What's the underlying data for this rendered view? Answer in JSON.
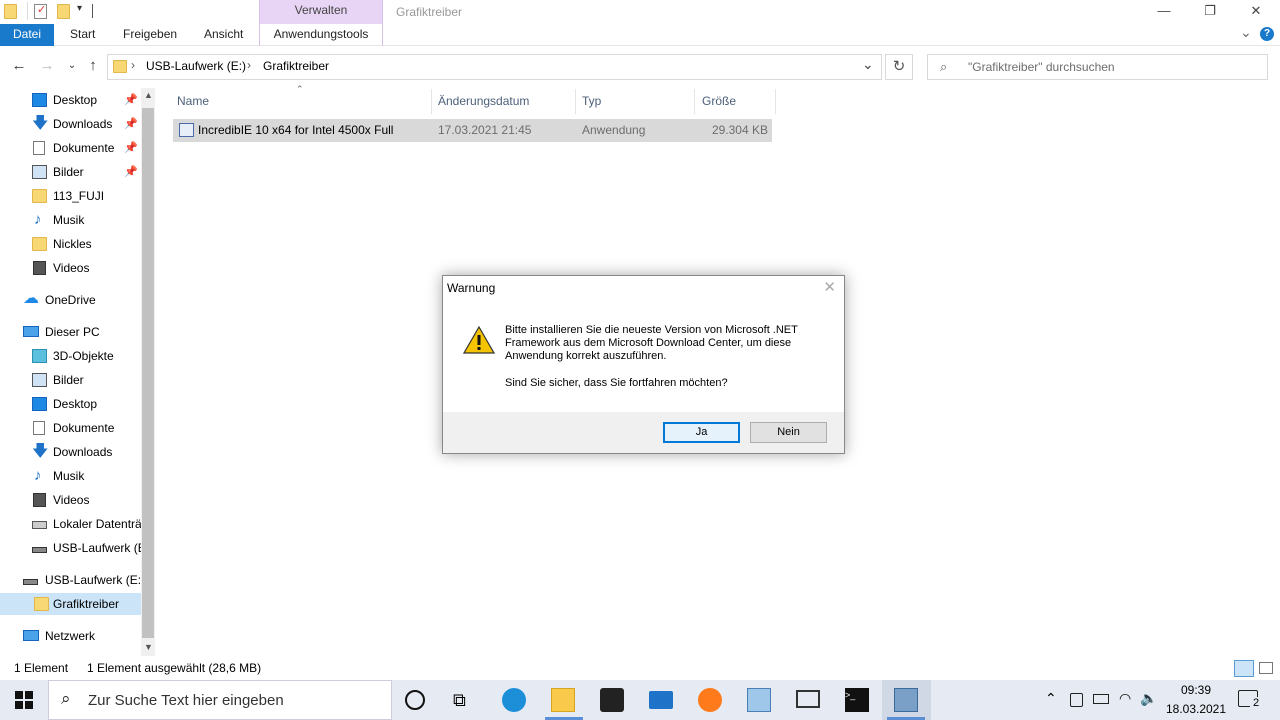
{
  "window": {
    "title": "Grafiktreiber",
    "context_group": "Verwalten",
    "controls": {
      "minimize": "—",
      "maximize": "❐",
      "close": "✕"
    }
  },
  "ribbon": {
    "tabs": [
      "Datei",
      "Start",
      "Freigeben",
      "Ansicht",
      "Anwendungstools"
    ],
    "expand_icon": "⌄",
    "help_icon": "?"
  },
  "address": {
    "crumbs": [
      "USB-Laufwerk (E:)",
      "Grafiktreiber"
    ],
    "separator": "›",
    "search_placeholder": "\"Grafiktreiber\" durchsuchen"
  },
  "nav": {
    "quick_access": [
      {
        "label": "Desktop",
        "icon": "desktop-icon",
        "pinned": true
      },
      {
        "label": "Downloads",
        "icon": "download-icon",
        "pinned": true
      },
      {
        "label": "Dokumente",
        "icon": "documents-icon",
        "pinned": true
      },
      {
        "label": "Bilder",
        "icon": "pictures-icon",
        "pinned": true
      },
      {
        "label": "113_FUJI",
        "icon": "folder-icon",
        "pinned": false
      },
      {
        "label": "Musik",
        "icon": "music-icon",
        "pinned": false
      },
      {
        "label": "Nickles",
        "icon": "folder-icon",
        "pinned": false
      },
      {
        "label": "Videos",
        "icon": "videos-icon",
        "pinned": false
      }
    ],
    "onedrive": "OneDrive",
    "this_pc": "Dieser PC",
    "pc_items": [
      {
        "label": "3D-Objekte",
        "icon": "3d-objects-icon"
      },
      {
        "label": "Bilder",
        "icon": "pictures-icon"
      },
      {
        "label": "Desktop",
        "icon": "desktop-icon"
      },
      {
        "label": "Dokumente",
        "icon": "documents-icon"
      },
      {
        "label": "Downloads",
        "icon": "download-icon"
      },
      {
        "label": "Musik",
        "icon": "music-icon"
      },
      {
        "label": "Videos",
        "icon": "videos-icon"
      },
      {
        "label": "Lokaler Datenträ",
        "icon": "local-disk-icon"
      },
      {
        "label": "USB-Laufwerk (E",
        "icon": "usb-drive-icon"
      }
    ],
    "usb": "USB-Laufwerk (E:)",
    "selected_folder": "Grafiktreiber",
    "network": "Netzwerk"
  },
  "columns": {
    "name": "Name",
    "date": "Änderungsdatum",
    "type": "Typ",
    "size": "Größe"
  },
  "files": [
    {
      "name": "IncredibIE 10 x64 for Intel 4500x Full",
      "date": "17.03.2021 21:45",
      "type": "Anwendung",
      "size": "29.304 KB"
    }
  ],
  "status": {
    "count": "1 Element",
    "selection": "1 Element ausgewählt (28,6 MB)"
  },
  "dialog": {
    "title": "Warnung",
    "message": "Bitte installieren Sie die neueste Version von Microsoft .NET Framework aus dem Microsoft Download Center, um diese Anwendung korrekt auszuführen.",
    "question": "Sind Sie sicher, dass Sie fortfahren möchten?",
    "yes": "Ja",
    "no": "Nein"
  },
  "taskbar": {
    "search_placeholder": "Zur Suche Text hier eingeben",
    "time": "09:39",
    "date": "18.03.2021",
    "notifications": "2"
  },
  "colors": {
    "accent": "#1979ca",
    "context_tab": "#e8d5f5",
    "selection": "#d9d9d9",
    "taskbar": "#e6eaf2"
  }
}
